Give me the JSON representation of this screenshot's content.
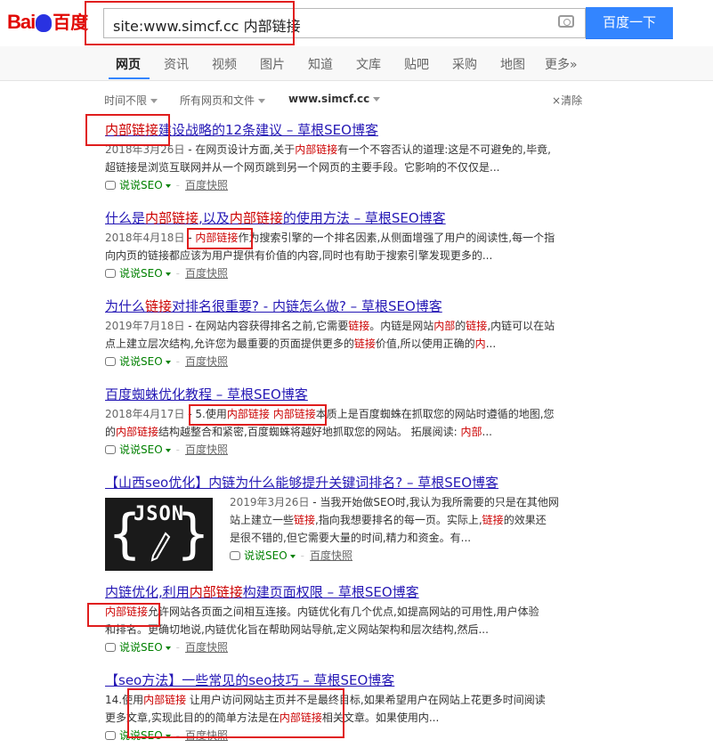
{
  "logo": {
    "text_bai": "Bai",
    "text_du": "du",
    "text_cn": "百度"
  },
  "search": {
    "query": "site:www.simcf.cc 内部链接",
    "button": "百度一下"
  },
  "tabs": [
    "网页",
    "资讯",
    "视频",
    "图片",
    "知道",
    "文库",
    "贴吧",
    "采购",
    "地图",
    "更多»"
  ],
  "filters": {
    "time": "时间不限",
    "type": "所有网页和文件",
    "site": "www.simcf.cc",
    "clear": "清除"
  },
  "footer_labels": {
    "shuo": "说说SEO",
    "cache": "百度快照"
  },
  "colors": {
    "brand_red": "#e10601",
    "link": "#2518b5",
    "highlight": "#c00",
    "button": "#3385ff",
    "annotation": "#e01d1d"
  },
  "results": [
    {
      "title": [
        "内部链接",
        "建设战略的12条建议 – 草根SEO博客"
      ],
      "date": "2018年3月26日",
      "abs_lines": [
        [
          " - 在网页设计方面,关于",
          "<em>内部链接</em>",
          "有一个不容否认的道理:这是不可避免的,毕竟,"
        ],
        [
          "超链接是浏览互联网并从一个网页跳到另一个网页的主要手段。它影响的不仅仅是..."
        ]
      ]
    },
    {
      "title": [
        "什么是",
        "内部链接",
        ",以及",
        "内部链接",
        "的使用方法 – 草根SEO博客"
      ],
      "date": "2018年4月18日",
      "abs_lines": [
        [
          " - ",
          "内部链接",
          "作为搜索引擎的一个排名因素,从侧面增强了用户的阅读性,每一个指"
        ],
        [
          "向内页的链接都应该为用户提供有价值的内容,同时也有助于搜索引擎发现更多的..."
        ]
      ]
    },
    {
      "title": [
        "为什么",
        "链接",
        "对排名很重要? - 内链怎么做? – 草根SEO博客"
      ],
      "date": "2019年7月18日",
      "abs_lines": [
        [
          " - 在网站内容获得排名之前,它需要",
          "链接",
          "。内链是网站",
          "内部",
          "的",
          "链接",
          ",内链可以在站"
        ],
        [
          "点上建立层次结构,允许您为最重要的页面提供更多的",
          "链接",
          "价值,所以使用正确的",
          "内",
          "..."
        ]
      ]
    },
    {
      "title": [
        "百度蜘蛛优化教程 – 草根SEO博客"
      ],
      "date": "2018年4月17日",
      "abs_lines": [
        [
          " - ",
          "5.使用",
          "内部链接",
          " ",
          "内部链接",
          "本质上是百度蜘蛛在抓取您的网站时遵循的地图,您"
        ],
        [
          "的",
          "内部链接",
          "结构越整合和紧密,百度蜘蛛将越好地抓取您的网站。 拓展阅读: ",
          "内部",
          "..."
        ]
      ]
    },
    {
      "title": [
        "【山西seo优化】内链为什么能够提升关键词排名? – 草根SEO博客"
      ],
      "thumb": "JSON",
      "date": "2019年3月26日",
      "abs_lines": [
        [
          " - 当我开始做SEO时,我认为我所需要的只是在其他网"
        ],
        [
          "站上建立一些",
          "链接",
          ",指向我想要排名的每一页。实际上,",
          "链接",
          "的效果还"
        ],
        [
          "是很不错的,但它需要大量的时间,精力和资金。有..."
        ]
      ]
    },
    {
      "title": [
        "内链优化,利用",
        "内部链接",
        "构建页面权限 – 草根SEO博客"
      ],
      "abs_lines": [
        [
          "内部链接",
          "允许网站各页面之间相互连接。内链优化有几个优点,如提高网站的可用性,用户体验"
        ],
        [
          "和排名。更确切地说,内链优化旨在帮助网站导航,定义网站架构和层次结构,然后..."
        ]
      ]
    },
    {
      "title": [
        "【seo方法】一些常见的seo技巧 – 草根SEO博客"
      ],
      "abs_lines": [
        [
          "14.使用",
          "内部链接",
          " 让用户访问网站主页并不是最终目标,如果希望用户在网站上花更多时间阅读"
        ],
        [
          "更多文章,实现此目的的简单方法是在",
          "内部链接",
          "相关文章。如果使用内..."
        ]
      ]
    }
  ]
}
